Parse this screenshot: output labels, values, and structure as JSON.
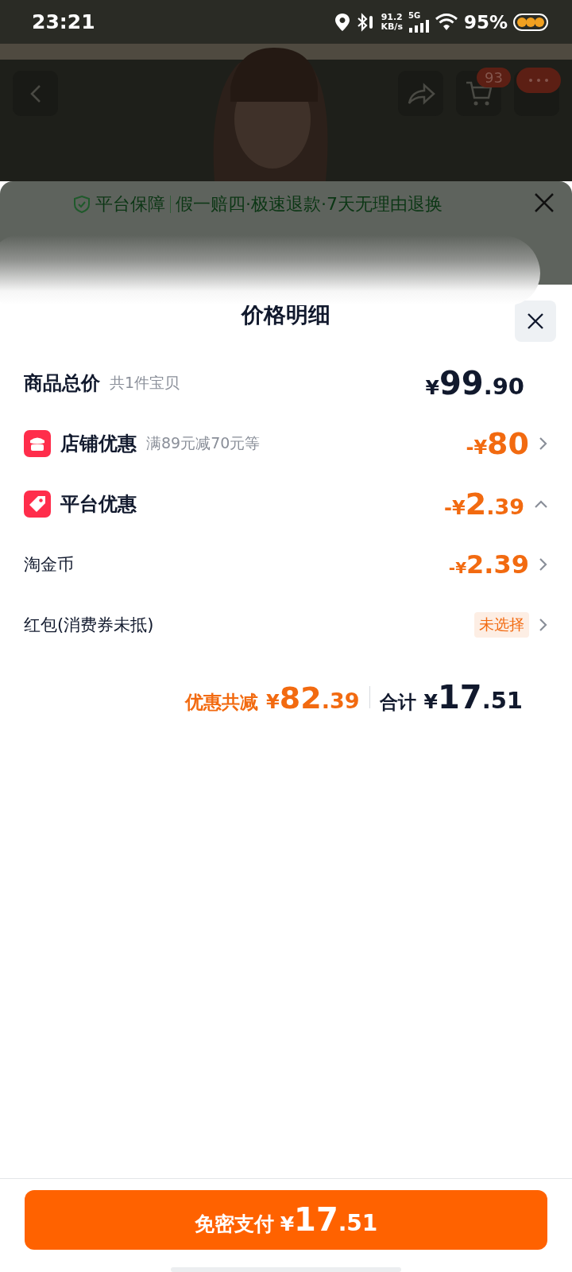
{
  "status_bar": {
    "time": "23:21",
    "net_speed": "91.2",
    "net_unit": "KB/s",
    "network": "5G",
    "battery": "95%"
  },
  "nav": {
    "cart_badge": "93"
  },
  "guarantee": {
    "label": "平台保障",
    "details": "假一赔四·极速退款·7天无理由退换"
  },
  "price_sheet": {
    "title": "价格明细",
    "rows": [
      {
        "kind": "total",
        "label": "商品总价",
        "note": "共1件宝贝",
        "amount": {
          "sign": "¥",
          "integer": "99",
          "decimal": ".90"
        }
      },
      {
        "kind": "shop",
        "label": "店铺优惠",
        "note": "满89元减70元等",
        "amount": {
          "sign": "-¥",
          "integer": "80"
        },
        "expanded": false
      },
      {
        "kind": "platform",
        "label": "平台优惠",
        "amount": {
          "sign": "-¥",
          "integer": "2",
          "decimal": ".39"
        },
        "expanded": true
      },
      {
        "kind": "sub",
        "label": "淘金币",
        "amount": {
          "sign": "-¥",
          "integer": "2.39"
        }
      },
      {
        "kind": "sub",
        "label": "红包(消费券未抵)",
        "pill": "未选择"
      }
    ],
    "summary": {
      "discount_label": "优惠共减",
      "discount": {
        "sign": "¥",
        "integer": "82",
        "decimal": ".39"
      },
      "total_label": "合计",
      "total": {
        "sign": "¥",
        "integer": "17",
        "decimal": ".51"
      }
    }
  },
  "pay_button": {
    "label": "免密支付",
    "amount": {
      "sign": "¥",
      "integer": "17",
      "decimal": ".51"
    }
  }
}
